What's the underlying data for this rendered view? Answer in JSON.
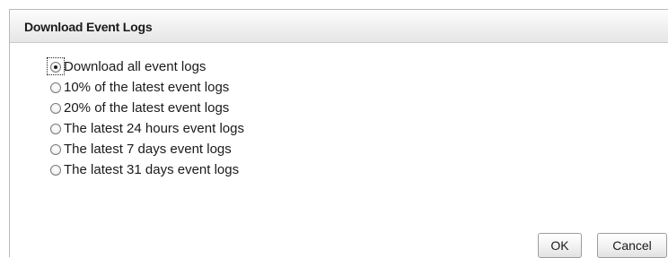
{
  "dialog": {
    "title": "Download Event Logs"
  },
  "options": [
    {
      "label": "Download all event logs",
      "checked": true
    },
    {
      "label": "10% of the latest event logs",
      "checked": false
    },
    {
      "label": "20% of the latest event logs",
      "checked": false
    },
    {
      "label": "The latest 24 hours event logs",
      "checked": false
    },
    {
      "label": "The latest 7 days event logs",
      "checked": false
    },
    {
      "label": "The latest 31 days event logs",
      "checked": false
    }
  ],
  "buttons": {
    "ok_label": "OK",
    "cancel_label": "Cancel"
  }
}
